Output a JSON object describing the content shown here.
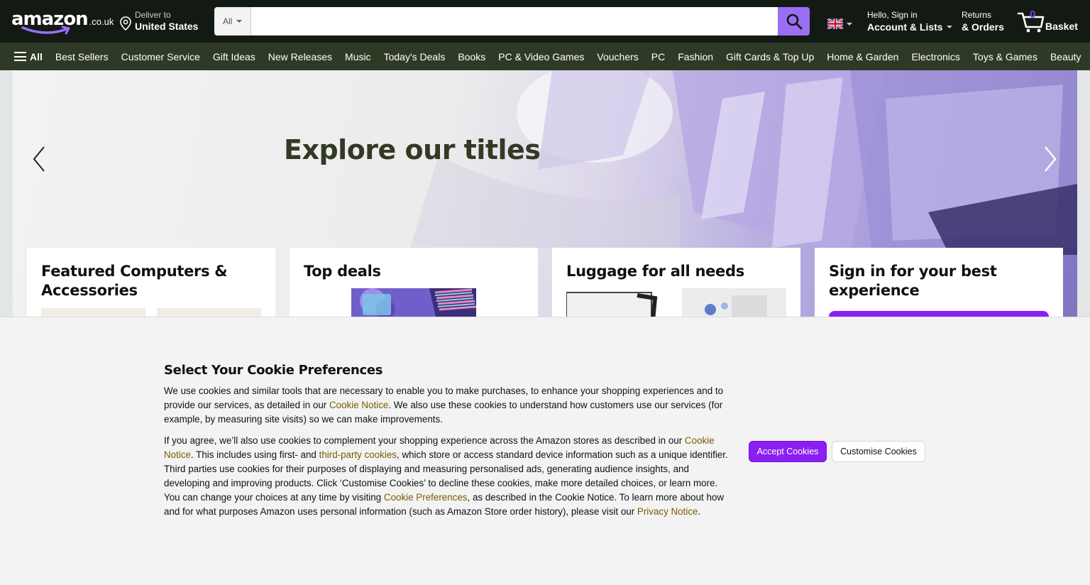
{
  "header": {
    "logo_word": "amazon",
    "logo_tld": ".co.uk",
    "deliver_line1": "Deliver to",
    "deliver_line2": "United States",
    "search_category": "All",
    "search_placeholder": "",
    "account_line1": "Hello, Sign in",
    "account_line2": "Account & Lists",
    "returns_line1": "Returns",
    "returns_line2": "& Orders",
    "basket_count": "0",
    "basket_label": "Basket"
  },
  "nav": {
    "all_label": "All",
    "links": [
      "Best Sellers",
      "Customer Service",
      "Gift Ideas",
      "New Releases",
      "Music",
      "Today's Deals",
      "Books",
      "PC & Video Games",
      "Vouchers",
      "PC",
      "Fashion",
      "Gift Cards & Top Up",
      "Home & Garden",
      "Electronics",
      "Toys & Games",
      "Beauty"
    ]
  },
  "hero": {
    "title": "Explore our titles"
  },
  "cards": [
    {
      "title": "Featured Computers & Accessories"
    },
    {
      "title": "Top deals"
    },
    {
      "title": "Luggage for all needs"
    },
    {
      "title": "Sign in for your best experience"
    }
  ],
  "cookie": {
    "heading": "Select Your Cookie Preferences",
    "p1_a": "We use cookies and similar tools that are necessary to enable you to make purchases, to enhance your shopping experiences and to provide our services, as detailed in our ",
    "p1_link": "Cookie Notice",
    "p1_b": ". We also use these cookies to understand how customers use our services (for example, by measuring site visits) so we can make improvements.",
    "p2_a": "If you agree, we’ll also use cookies to complement your shopping experience across the Amazon stores as described in our ",
    "p2_link1": "Cookie Notice",
    "p2_b": ". This includes using first- and ",
    "p2_link2": "third-party cookies",
    "p2_c": ", which store or access standard device information such as a unique identifier. Third parties use cookies for their purposes of displaying and measuring personalised ads, generating audience insights, and developing and improving products. Click ‘Customise Cookies’ to decline these cookies, make more detailed choices, or learn more. You can change your choices at any time by visiting ",
    "p2_link3": "Cookie Preferences",
    "p2_d": ", as described in the Cookie Notice. To learn more about how and for what purposes Amazon uses personal information (such as Amazon Store order history), please visit our ",
    "p2_link4": "Privacy Notice",
    "p2_e": ".",
    "accept_label": "Accept Cookies",
    "customise_label": "Customise Cookies"
  },
  "colors": {
    "header_bg": "#131a14",
    "nav_bg": "#2f3a26",
    "accent": "#8a1ff2",
    "link": "#7a5b00"
  }
}
